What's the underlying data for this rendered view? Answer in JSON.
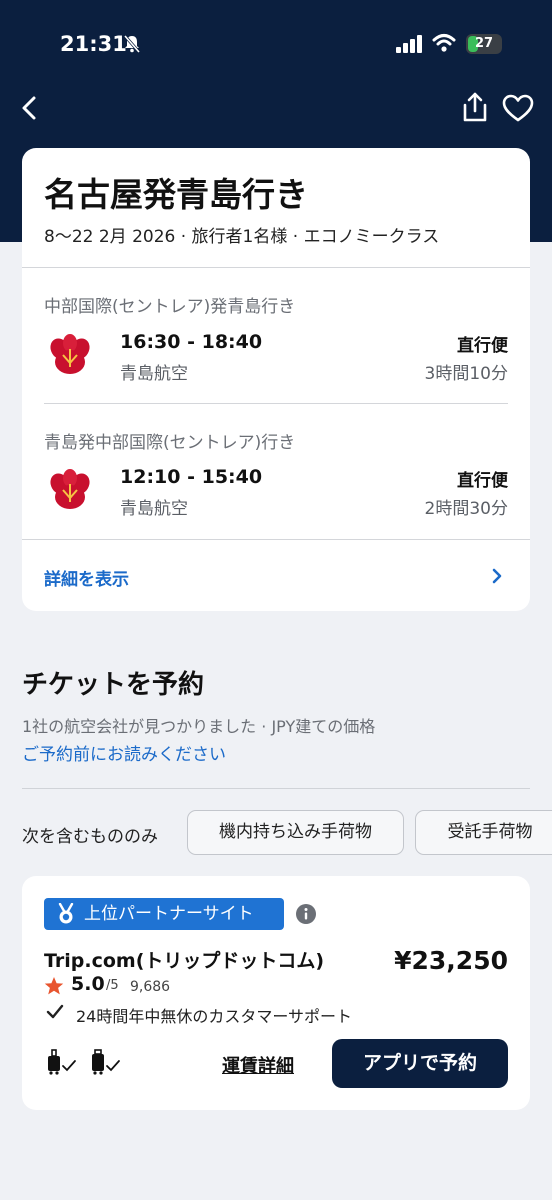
{
  "status_bar": {
    "time": "21:31",
    "battery": "27"
  },
  "summary": {
    "title": "名古屋発青島行き",
    "meta": "8〜22 2月 2026 · 旅行者1名様 · エコノミークラス",
    "legs": [
      {
        "title": "中部国際(セントレア)発青島行き",
        "times": "16:30 - 18:40",
        "airline": "青島航空",
        "type": "直行便",
        "duration": "3時間10分"
      },
      {
        "title": "青島発中部国際(セントレア)行き",
        "times": "12:10 - 15:40",
        "airline": "青島航空",
        "type": "直行便",
        "duration": "2時間30分"
      }
    ],
    "details_link": "詳細を表示"
  },
  "booking": {
    "title": "チケットを予約",
    "subtitle": "1社の航空会社が見つかりました · JPY建ての価格",
    "read_link": "ご予約前にお読みください",
    "filter_label": "次を含むもののみ",
    "filters": [
      "機内持ち込み手荷物",
      "受託手荷物"
    ]
  },
  "offer": {
    "badge": "上位パートナーサイト",
    "vendor": "Trip.com(トリップドットコム)",
    "price": "¥23,250",
    "rating": "5.0",
    "rating_max": "/5",
    "reviews": "9,686",
    "support": "24時間年中無休のカスタマーサポート",
    "fare_details": "運賃詳細",
    "book_button": "アプリで予約"
  },
  "colors": {
    "header": "#0b1f3f",
    "link": "#1b6ac9",
    "badge": "#1f73d3",
    "airline": "#c8102e",
    "star": "#e8552f"
  }
}
